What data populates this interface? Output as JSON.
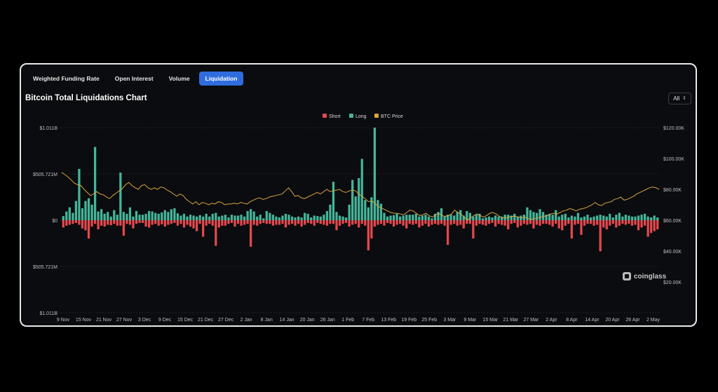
{
  "tabs": [
    {
      "label": "Weighted Funding Rate",
      "active": false
    },
    {
      "label": "Open Interest",
      "active": false
    },
    {
      "label": "Volume",
      "active": false
    },
    {
      "label": "Liquidation",
      "active": true
    }
  ],
  "range_selector": {
    "value": "All"
  },
  "watermark": {
    "text": "coinglass"
  },
  "colors": {
    "short": "#e5484d",
    "long": "#46b59a",
    "price": "#d9a53f",
    "accent": "#2f6ddf"
  },
  "chart_data": {
    "type": "bar",
    "title": "Bitcoin Total Liquidations Chart",
    "legend": {
      "placement": "top-center",
      "entries": [
        "Short",
        "Long",
        "BTC Price"
      ]
    },
    "left_axis": {
      "ylim": [
        -1011000000,
        1011000000
      ],
      "tick_values": [
        1011000000,
        505721000,
        0,
        -505721000,
        -1011000000
      ],
      "tick_labels": [
        "$1.011B",
        "$505.721M",
        "$0",
        "$505.721M",
        "$1.011B"
      ]
    },
    "right_axis": {
      "ylim": [
        0,
        120000
      ],
      "tick_values": [
        120000,
        100000,
        80000,
        60000,
        40000,
        20000
      ],
      "tick_labels": [
        "$120.00K",
        "$100.00K",
        "$80.00K",
        "$60.00K",
        "$40.00K",
        "$20.00K"
      ]
    },
    "x_tick_labels": [
      "9 Nov",
      "15 Nov",
      "21 Nov",
      "27 Nov",
      "3 Dec",
      "9 Dec",
      "15 Dec",
      "21 Dec",
      "27 Dec",
      "2 Jan",
      "8 Jan",
      "14 Jan",
      "20 Jan",
      "26 Jan",
      "1 Feb",
      "7 Feb",
      "13 Feb",
      "19 Feb",
      "25 Feb",
      "3 Mar",
      "9 Mar",
      "15 Mar",
      "21 Mar",
      "27 Mar",
      "2 Apr",
      "8 Apr",
      "14 Apr",
      "20 Apr",
      "26 Apr",
      "2 May"
    ],
    "grid": true,
    "series": [
      {
        "name": "Long",
        "values": [
          45,
          95,
          140,
          80,
          210,
          560,
          130,
          210,
          240,
          170,
          800,
          95,
          120,
          70,
          90,
          40,
          110,
          60,
          520,
          90,
          70,
          140,
          40,
          100,
          60,
          60,
          70,
          100,
          95,
          80,
          70,
          85,
          110,
          90,
          120,
          130,
          75,
          50,
          70,
          40,
          60,
          50,
          40,
          55,
          40,
          70,
          40,
          70,
          80,
          40,
          50,
          60,
          30,
          60,
          50,
          50,
          60,
          40,
          100,
          120,
          95,
          40,
          60,
          20,
          100,
          80,
          60,
          40,
          30,
          50,
          70,
          60,
          40,
          30,
          40,
          30,
          80,
          70,
          30,
          50,
          45,
          40,
          60,
          100,
          170,
          420,
          90,
          50,
          40,
          30,
          170,
          440,
          260,
          460,
          670,
          220,
          140,
          250,
          1011,
          220,
          180,
          80,
          40,
          50,
          55,
          70,
          40,
          50,
          60,
          60,
          60,
          70,
          40,
          50,
          60,
          40,
          20,
          70,
          90,
          130,
          40,
          60,
          60,
          50,
          90,
          110,
          50,
          100,
          80,
          40,
          60,
          70,
          20,
          30,
          40,
          30,
          50,
          40,
          40,
          60,
          60,
          50,
          70,
          40,
          50,
          60,
          140,
          110,
          90,
          80,
          120,
          90,
          60,
          70,
          60,
          110,
          40,
          60,
          70,
          30,
          50,
          40,
          80,
          30,
          40,
          60,
          30,
          40,
          50,
          60,
          50,
          40,
          70,
          30,
          60,
          80,
          40,
          60,
          50,
          40,
          40,
          50,
          60,
          70,
          40,
          30,
          50,
          30
        ],
        "approx_count": 188
      },
      {
        "name": "Short",
        "values": [
          80,
          60,
          50,
          40,
          30,
          50,
          90,
          110,
          200,
          70,
          40,
          100,
          60,
          70,
          50,
          55,
          40,
          60,
          60,
          170,
          40,
          50,
          90,
          40,
          30,
          30,
          70,
          80,
          50,
          40,
          60,
          45,
          70,
          50,
          40,
          30,
          60,
          40,
          80,
          50,
          70,
          90,
          120,
          40,
          180,
          60,
          40,
          60,
          280,
          80,
          60,
          60,
          40,
          30,
          70,
          40,
          60,
          50,
          40,
          290,
          50,
          60,
          40,
          30,
          40,
          40,
          60,
          50,
          50,
          40,
          80,
          50,
          40,
          60,
          40,
          70,
          50,
          30,
          40,
          60,
          30,
          40,
          50,
          60,
          40,
          40,
          110,
          60,
          40,
          30,
          70,
          50,
          40,
          80,
          40,
          60,
          330,
          200,
          70,
          50,
          40,
          60,
          30,
          40,
          70,
          50,
          40,
          60,
          90,
          40,
          50,
          40,
          80,
          60,
          40,
          70,
          50,
          40,
          50,
          40,
          60,
          270,
          50,
          40,
          60,
          50,
          90,
          40,
          40,
          200,
          60,
          40,
          50,
          60,
          40,
          30,
          70,
          40,
          50,
          60,
          100,
          40,
          30,
          80,
          60,
          40,
          50,
          40,
          90,
          50,
          60,
          40,
          40,
          50,
          70,
          40,
          90,
          110,
          60,
          40,
          200,
          50,
          40,
          160,
          60,
          40,
          40,
          60,
          50,
          340,
          80,
          100,
          60,
          40,
          80,
          60,
          40,
          50,
          40,
          60,
          50,
          110,
          80,
          60,
          180,
          140,
          120,
          100
        ],
        "approx_count": 188
      },
      {
        "name": "BTC Price",
        "values": [
          91000,
          89500,
          88000,
          86000,
          84000,
          83000,
          82500,
          80000,
          78000,
          76000,
          77000,
          78500,
          77000,
          76500,
          75000,
          74000,
          76000,
          77500,
          79000,
          80500,
          83000,
          84500,
          82500,
          81000,
          80000,
          82500,
          83000,
          81000,
          80000,
          81000,
          80000,
          81500,
          81000,
          79500,
          78500,
          77000,
          75500,
          77000,
          76000,
          73500,
          72000,
          70500,
          72000,
          70000,
          71500,
          71000,
          70000,
          71000,
          70500,
          72000,
          71500,
          70000,
          70500,
          70500,
          71000,
          70500,
          71500,
          71000,
          70500,
          72000,
          73000,
          74000,
          74500,
          73500,
          74000,
          75000,
          75500,
          76000,
          76500,
          77000,
          79000,
          81000,
          78500,
          75500,
          76000,
          74500,
          74000,
          75000,
          76000,
          77000,
          78000,
          77000,
          78500,
          80000,
          78500,
          79000,
          79500,
          80000,
          78500,
          78000,
          79000,
          79500,
          79000,
          77000,
          75500,
          74000,
          72000,
          72500,
          71000,
          69000,
          68000,
          67000,
          66000,
          65000,
          64500,
          64500,
          64000,
          63500,
          65000,
          66500,
          66000,
          64500,
          63000,
          63500,
          64500,
          63000,
          62000,
          63500,
          64500,
          63000,
          62500,
          63000,
          64000,
          66500,
          65000,
          64000,
          62000,
          60000,
          61500,
          63000,
          64000,
          63000,
          62000,
          63000,
          64500,
          65000,
          64000,
          62500,
          61500,
          61500,
          62000,
          62500,
          62500,
          62000,
          61500,
          62000,
          61000,
          60500,
          61000,
          61500,
          62000,
          62500,
          63000,
          64000,
          64500,
          64000,
          65000,
          66000,
          66500,
          67500,
          67000,
          66000,
          67000,
          67500,
          68000,
          69000,
          70000,
          71500,
          70000,
          69500,
          71000,
          71500,
          72000,
          73500,
          74000,
          75000,
          73000,
          73500,
          74500,
          75500,
          77000,
          78000,
          79000,
          80000,
          81000,
          81500,
          81000,
          80000
        ],
        "approx_count": 188
      }
    ]
  }
}
